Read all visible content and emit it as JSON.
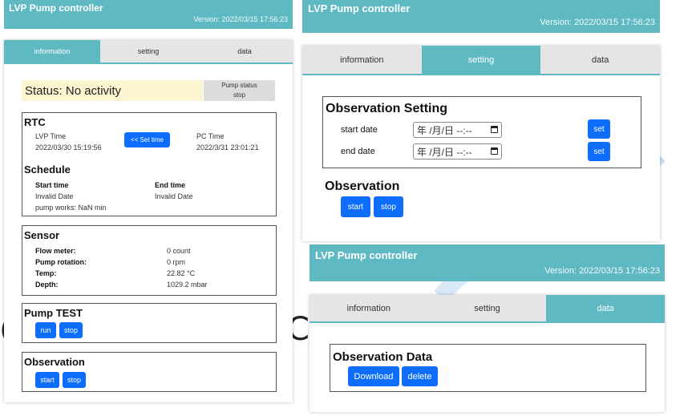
{
  "app": {
    "title": "LVP Pump controller",
    "version": "Version: 2022/03/15 17:56:23"
  },
  "tabs": {
    "information": "information",
    "setting": "setting",
    "data": "data"
  },
  "info": {
    "status": "Status: No activity",
    "pump_status_label": "Pump status",
    "pump_status_value": "stop",
    "rtc": {
      "title": "RTC",
      "lvp_time_label": "LVP Time",
      "lvp_time_value": "2022/03/30 15:19:56",
      "set_time_button": "<< Set time",
      "pc_time_label": "PC Time",
      "pc_time_value": "2022/3/31 23:01:21"
    },
    "schedule": {
      "title": "Schedule",
      "start_label": "Start time",
      "end_label": "End time",
      "start_value": "Invalid Date",
      "end_value": "Invalid Date",
      "pump_works": "pump works: NaN min"
    },
    "sensor": {
      "title": "Sensor",
      "rows": [
        {
          "label": "Flow meter:",
          "value": "0 count"
        },
        {
          "label": "Pump rotation:",
          "value": "0 rpm"
        },
        {
          "label": "Temp:",
          "value": "22.82 °C"
        },
        {
          "label": "Depth:",
          "value": "1029.2 mbar"
        }
      ]
    },
    "pump_test": {
      "title": "Pump TEST",
      "run": "run",
      "stop": "stop"
    },
    "observation": {
      "title": "Observation",
      "start": "start",
      "stop": "stop"
    }
  },
  "setting": {
    "title": "Observation Setting",
    "start_date_label": "start date",
    "end_date_label": "end date",
    "date_placeholder": "年 /月/日 --:--",
    "set_button": "set",
    "observation_title": "Observation",
    "start": "start",
    "stop": "stop"
  },
  "data_panel": {
    "title": "Observation Data",
    "download": "Download",
    "delete": "delete"
  },
  "colors": {
    "accent": "#5fb9c3",
    "button": "#0d6efd",
    "status_bg": "#fdf5cf"
  }
}
